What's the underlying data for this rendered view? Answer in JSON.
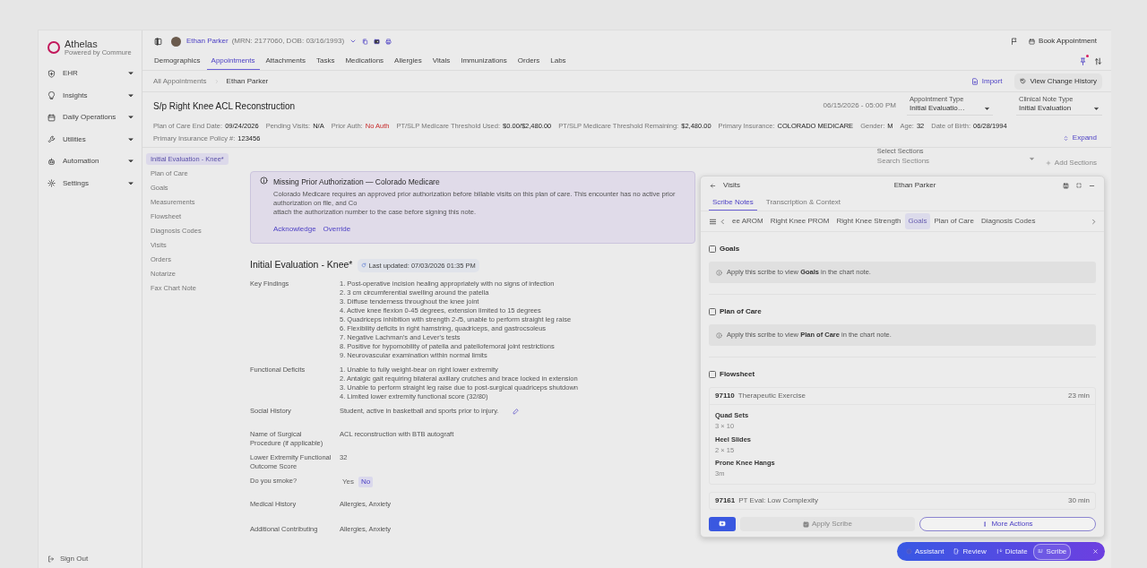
{
  "sidebar": {
    "logo": {
      "name": "Athelas",
      "tagline": "Powered by Commure"
    },
    "items": [
      {
        "label": "EHR"
      },
      {
        "label": "Insights"
      },
      {
        "label": "Daily Operations"
      },
      {
        "label": "Utilities"
      },
      {
        "label": "Automation"
      },
      {
        "label": "Settings"
      }
    ],
    "sign_out": "Sign Out"
  },
  "patient": {
    "name": "Ethan Parker",
    "details": "(MRN: 2177060, DOB: 03/16/1993)"
  },
  "book_appointment": "Book Appointment",
  "tabs": [
    {
      "label": "Demographics",
      "selected": false
    },
    {
      "label": "Appointments",
      "selected": true
    },
    {
      "label": "Attachments",
      "selected": false
    },
    {
      "label": "Tasks",
      "selected": false
    },
    {
      "label": "Medications",
      "selected": false
    },
    {
      "label": "Allergies",
      "selected": false
    },
    {
      "label": "Vitals",
      "selected": false
    },
    {
      "label": "Immunizations",
      "selected": false
    },
    {
      "label": "Orders",
      "selected": false
    },
    {
      "label": "Labs",
      "selected": false
    }
  ],
  "breadcrumb": [
    "All Appointments",
    "Ethan Parker"
  ],
  "import": "Import",
  "view_change_history": "View Change History",
  "case_title": "S/p Right Knee ACL Reconstruction",
  "appointment_datetime": "06/15/2026 - 05:00 PM",
  "appointment_type": {
    "label": "Appointment Type",
    "value": "Initial Evaluatio…"
  },
  "clinical_note_type": {
    "label": "Clinical Note Type",
    "value": "Initial Evaluation"
  },
  "info": [
    {
      "label": "Plan of Care End Date:",
      "value": "09/24/2026",
      "alert": false
    },
    {
      "label": "Pending Visits:",
      "value": "N/A",
      "alert": false
    },
    {
      "label": "Prior Auth:",
      "value": "No Auth",
      "alert": true
    },
    {
      "label": "PT/SLP Medicare Threshold Used:",
      "value": "$0.00/$2,480.00",
      "alert": false
    },
    {
      "label": "PT/SLP Medicare Threshold Remaining:",
      "value": "$2,480.00",
      "alert": false
    },
    {
      "label": "Primary Insurance:",
      "value": "COLORADO MEDICARE",
      "alert": false
    },
    {
      "label": "Gender:",
      "value": "M",
      "alert": false
    },
    {
      "label": "Age:",
      "value": "32",
      "alert": false
    },
    {
      "label": "Date of Birth:",
      "value": "06/28/1994",
      "alert": false
    },
    {
      "label": "Primary Insurance Policy #:",
      "value": "123456",
      "alert": false
    }
  ],
  "expand": "Expand",
  "section_nav": [
    {
      "label": "Initial Evaluation - Knee*",
      "selected": true
    },
    {
      "label": "Plan of Care",
      "selected": false
    },
    {
      "label": "Goals",
      "selected": false
    },
    {
      "label": "Measurements",
      "selected": false
    },
    {
      "label": "Flowsheet",
      "selected": false
    },
    {
      "label": "Diagnosis Codes",
      "selected": false
    },
    {
      "label": "Visits",
      "selected": false
    },
    {
      "label": "Orders",
      "selected": false
    },
    {
      "label": "Notarize",
      "selected": false
    },
    {
      "label": "Fax Chart Note",
      "selected": false
    }
  ],
  "section_picker": {
    "label": "Select Sections",
    "placeholder": "Search Sections",
    "add": "Add Sections"
  },
  "alert": {
    "title": "Missing Prior Authorization — Colorado Medicare",
    "lines": [
      "Colorado Medicare requires an approved prior authorization before billable visits on this plan of care. This encounter has no active prior authorization on file, and Co",
      "attach the authorization number to the case before signing this note."
    ],
    "actions": [
      "Acknowledge",
      "Override"
    ]
  },
  "note": {
    "title": "Initial Evaluation - Knee*",
    "last_updated": "Last updated: 07/03/2026 01:35 PM",
    "fields": [
      {
        "kind": "list",
        "label": "Key Findings",
        "items": [
          "1. Post-operative incision healing appropriately with no signs of infection",
          "2. 3 cm circumferential swelling around the patella",
          "3. Diffuse tenderness throughout the knee joint",
          "4. Active knee flexion 0-45 degrees, extension limited to 15 degrees",
          "5. Quadriceps inhibition with strength 2-/5, unable to perform straight leg raise",
          "6. Flexibility deficits in right hamstring, quadriceps, and gastrocsoleus",
          "7. Negative Lachman's and Lever's tests",
          "8. Positive for hypomobility of patella and patellofemoral joint restrictions",
          "9. Neurovascular examination within normal limits"
        ]
      },
      {
        "kind": "list",
        "label": "Functional Deficits",
        "items": [
          "1. Unable to fully weight-bear on right lower extremity",
          "2. Antalgic gait requiring bilateral axillary crutches and brace locked in extension",
          "3. Unable to perform straight leg raise due to post-surgical quadriceps shutdown",
          "4. Limited lower extremity functional score (32/80)"
        ]
      },
      {
        "kind": "text",
        "label": "Social History",
        "value": "Student, active in basketball and sports prior to injury.",
        "editable": true
      },
      {
        "kind": "text",
        "label": "Name of Surgical Procedure (if applicable)",
        "value": "ACL reconstruction with BTB autograft",
        "editable": false
      },
      {
        "kind": "text",
        "label": "Lower Extremity Functional Outcome Score",
        "value": "32",
        "editable": false
      },
      {
        "kind": "choice",
        "label": "Do you smoke?",
        "options": [
          {
            "label": "Yes",
            "selected": false
          },
          {
            "label": "No",
            "selected": true
          }
        ]
      },
      {
        "kind": "text",
        "label": "Medical History",
        "value": "Allergies, Anxiety",
        "editable": false
      },
      {
        "kind": "text",
        "label": "Additional Contributing",
        "value": "Allergies, Anxiety",
        "editable": false
      }
    ]
  },
  "scribe_panel": {
    "back": "Visits",
    "title": "Ethan Parker",
    "tabs": [
      {
        "label": "Scribe Notes",
        "selected": true
      },
      {
        "label": "Transcription & Context",
        "selected": false
      }
    ],
    "chips": [
      {
        "label": "ee AROM",
        "selected": false
      },
      {
        "label": "Right Knee PROM",
        "selected": false
      },
      {
        "label": "Right Knee Strength",
        "selected": false
      },
      {
        "label": "Goals",
        "selected": true
      },
      {
        "label": "Plan of Care",
        "selected": false
      },
      {
        "label": "Diagnosis Codes",
        "selected": false
      }
    ],
    "sections": [
      {
        "kind": "note",
        "title": "Goals",
        "checked": false,
        "note": "Apply this scribe to view **Goals** in the chart note."
      },
      {
        "kind": "note",
        "title": "Plan of Care",
        "checked": false,
        "note": "Apply this scribe to view **Plan of Care** in the chart note."
      },
      {
        "kind": "flowsheet",
        "title": "Flowsheet",
        "checked": false,
        "entries": [
          {
            "code": "97110",
            "name": "Therapeutic Exercise",
            "minutes": "23 min",
            "exercises": [
              {
                "name": "Quad Sets",
                "dose": "3 × 10"
              },
              {
                "name": "Heel Slides",
                "dose": "2 × 15"
              },
              {
                "name": "Prone Knee Hangs",
                "dose": "3m"
              }
            ]
          },
          {
            "code": "97161",
            "name": "PT Eval: Low Complexity",
            "minutes": "30 min"
          }
        ]
      }
    ],
    "apply": {
      "label": "Apply Scribe",
      "disabled": true
    },
    "more_actions": "More Actions"
  },
  "assistant_bar": [
    {
      "label": "Assistant",
      "selected": false
    },
    {
      "label": "Review",
      "selected": false
    },
    {
      "label": "Dictate",
      "selected": false
    },
    {
      "label": "Scribe",
      "selected": true
    }
  ]
}
